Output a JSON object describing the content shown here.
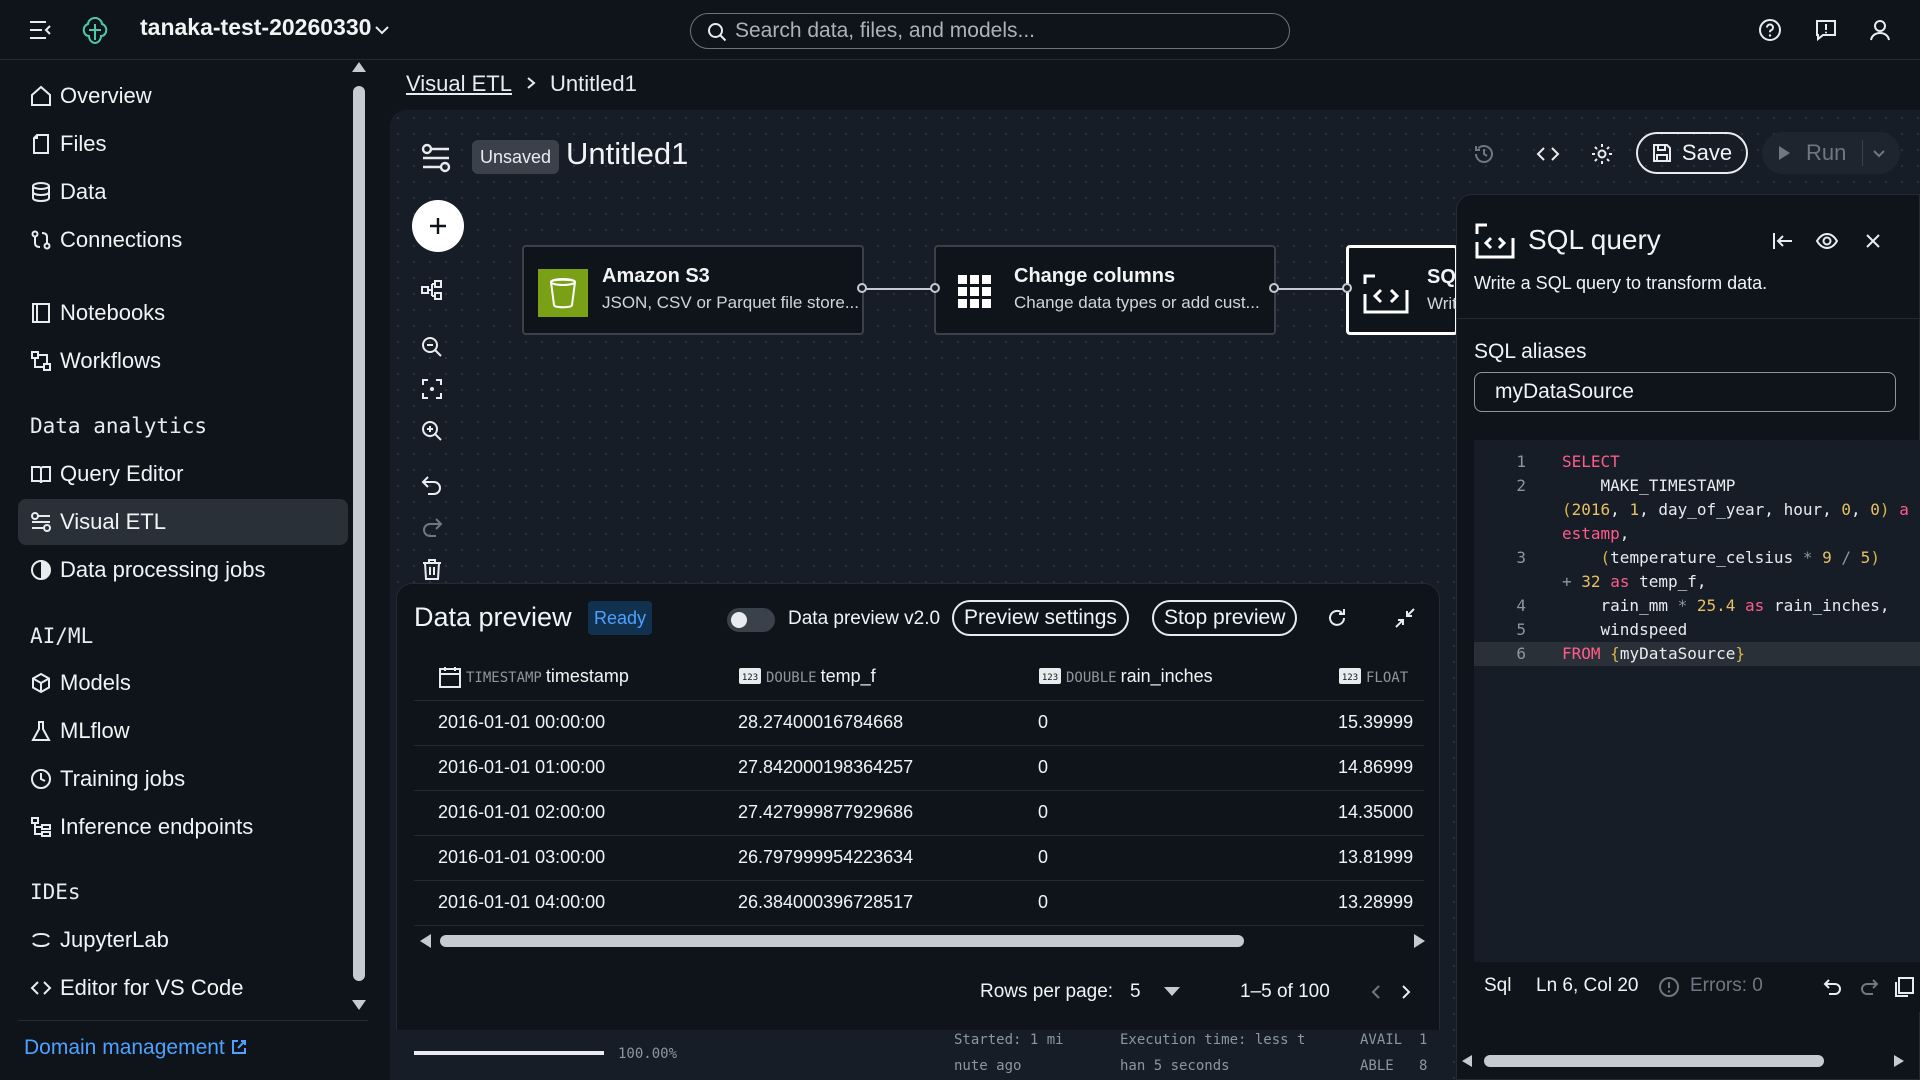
{
  "topbar": {
    "project": "tanaka-test-20260330",
    "search_placeholder": "Search data, files, and models..."
  },
  "sidebar": {
    "items": [
      {
        "label": "Overview"
      },
      {
        "label": "Files"
      },
      {
        "label": "Data"
      },
      {
        "label": "Connections"
      },
      {
        "label": "Notebooks"
      },
      {
        "label": "Workflows"
      },
      {
        "label": "Query Editor"
      },
      {
        "label": "Visual ETL"
      },
      {
        "label": "Data processing jobs"
      },
      {
        "label": "Models"
      },
      {
        "label": "MLflow"
      },
      {
        "label": "Training jobs"
      },
      {
        "label": "Inference endpoints"
      },
      {
        "label": "JupyterLab"
      },
      {
        "label": "Editor for VS Code"
      }
    ],
    "sections": [
      "Data analytics",
      "AI/ML",
      "IDEs"
    ],
    "active": "Visual ETL",
    "domain_management": "Domain management"
  },
  "breadcrumb": {
    "link": "Visual ETL",
    "current": "Untitled1"
  },
  "header": {
    "badge": "Unsaved",
    "title": "Untitled1",
    "save_label": "Save",
    "run_label": "Run"
  },
  "nodes": [
    {
      "title": "Amazon S3",
      "subtitle": "JSON, CSV or Parquet file store..."
    },
    {
      "title": "Change columns",
      "subtitle": "Change data types or add cust..."
    },
    {
      "title": "SQ",
      "subtitle": "Writ"
    }
  ],
  "preview": {
    "title": "Data preview",
    "status": "Ready",
    "toggle_label": "Data preview v2.0",
    "settings_label": "Preview settings",
    "stop_label": "Stop preview",
    "columns": [
      {
        "type": "TIMESTAMP",
        "name": "timestamp"
      },
      {
        "type": "DOUBLE",
        "name": "temp_f"
      },
      {
        "type": "DOUBLE",
        "name": "rain_inches"
      },
      {
        "type": "FLOAT",
        "name": ""
      }
    ],
    "rows": [
      [
        "2016-01-01 00:00:00",
        "28.27400016784668",
        "0",
        "15.39999"
      ],
      [
        "2016-01-01 01:00:00",
        "27.842000198364257",
        "0",
        "14.86999"
      ],
      [
        "2016-01-01 02:00:00",
        "27.427999877929686",
        "0",
        "14.35000"
      ],
      [
        "2016-01-01 03:00:00",
        "26.797999954223634",
        "0",
        "13.81999"
      ],
      [
        "2016-01-01 04:00:00",
        "26.384000396728517",
        "0",
        "13.28999"
      ]
    ],
    "rows_per_page_label": "Rows per page:",
    "rows_per_page": "5",
    "range": "1–5 of 100",
    "progress": 100,
    "progress_text": "100.00%",
    "started": "Started: 1 mi\nnute ago",
    "execution": "Execution time: less t\nhan 5 seconds",
    "avail": "AVAIL  1\nABLE   8"
  },
  "sql_panel": {
    "title": "SQL query",
    "description": "Write a SQL query to transform data.",
    "aliases_label": "SQL aliases",
    "alias_value": "myDataSource",
    "language": "Sql",
    "position": "Ln 6, Col 20",
    "errors": "Errors: 0"
  },
  "code_lines": [
    {
      "n": "1",
      "html": "<span class='kw'>SELECT</span>"
    },
    {
      "n": "2",
      "html": "    MAKE_TIMESTAMP"
    },
    {
      "n": "",
      "html": "<span class='pun'>(</span><span class='num'>2016</span>, <span class='num'>1</span>, day_of_year, hour, <span class='num'>0</span>, <span class='num'>0</span><span class='pun'>)</span> <span class='kw'>a</span>"
    },
    {
      "n": "",
      "html": "<span class='kw'>estamp</span>,"
    },
    {
      "n": "3",
      "html": "    <span class='pun'>(</span>temperature_celsius <span class='op'>*</span> <span class='num'>9</span> <span class='op'>/</span> <span class='num'>5</span><span class='pun'>)</span>"
    },
    {
      "n": "",
      "html": "<span class='op'>+</span> <span class='num'>32</span> <span class='kw'>as</span> temp_f,"
    },
    {
      "n": "4",
      "html": "    rain_mm <span class='op'>*</span> <span class='num'>25.4</span> <span class='kw'>as</span> rain_inches,"
    },
    {
      "n": "5",
      "html": "    windspeed"
    },
    {
      "n": "6",
      "html": "<span class='kw'>FROM</span> <span class='pun'>{</span>myDataSource<span class='pun'>}</span>"
    }
  ],
  "colors": {
    "accent": "#4ea1ff",
    "keyword": "#ff5c8a",
    "number": "#e8c062",
    "s3_green": "#7aa116"
  }
}
